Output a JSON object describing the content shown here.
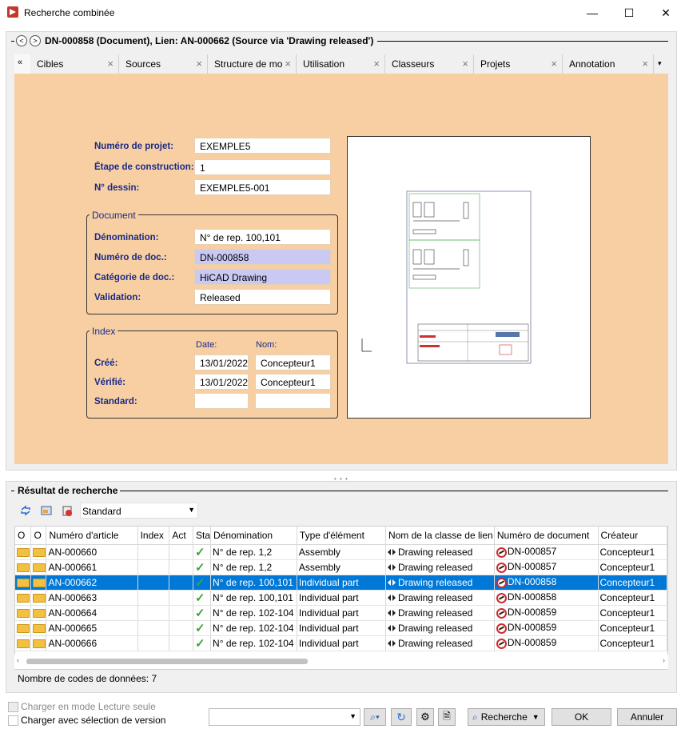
{
  "window": {
    "title": "Recherche combinée",
    "minimize": "—",
    "maximize": "☐",
    "close": "✕"
  },
  "header": {
    "prev": "<",
    "next": ">",
    "title": "DN-000858 (Document), Lien: AN-000662 (Source via 'Drawing released')"
  },
  "tabs": {
    "collapse": "«",
    "more": "▾",
    "items": [
      "Cibles",
      "Sources",
      "Structure de mo",
      "Utilisation",
      "Classeurs",
      "Projets",
      "Annotation"
    ]
  },
  "form": {
    "project_label": "Numéro de projet:",
    "project_value": "EXEMPLE5",
    "stage_label": "Étape de construction:",
    "stage_value": "1",
    "drawing_label": "N° dessin:",
    "drawing_value": "EXEMPLE5-001",
    "document_group": "Document",
    "name_label": "Dénomination:",
    "name_value": "N° de rep. 100,101",
    "docnum_label": "Numéro de doc.:",
    "docnum_value": "DN-000858",
    "category_label": "Catégorie de doc.:",
    "category_value": "HiCAD Drawing",
    "validation_label": "Validation:",
    "validation_value": "Released",
    "index_group": "Index",
    "date_col": "Date:",
    "name_col": "Nom:",
    "created_label": "Créé:",
    "created_date": "13/01/2022",
    "created_name": "Concepteur1",
    "checked_label": "Vérifié:",
    "checked_date": "13/01/2022",
    "checked_name": "Concepteur1",
    "standard_label": "Standard:",
    "standard_date": "",
    "standard_name": ""
  },
  "results": {
    "title": "Résultat de recherche",
    "view_combo": "Standard",
    "columns": [
      "O",
      "O",
      "Numéro d'article",
      "Index",
      "Act",
      "Sta",
      "Dénomination",
      "Type d'élément",
      "Nom de la classe de lien",
      "Numéro de document",
      "Créateur"
    ],
    "rows": [
      {
        "article": "AN-000660",
        "name": "N° de rep. 1,2",
        "type": "Assembly",
        "link": "Drawing released",
        "doc": "DN-000857",
        "creator": "Concepteur1",
        "selected": false
      },
      {
        "article": "AN-000661",
        "name": "N° de rep. 1,2",
        "type": "Assembly",
        "link": "Drawing released",
        "doc": "DN-000857",
        "creator": "Concepteur1",
        "selected": false
      },
      {
        "article": "AN-000662",
        "name": "N° de rep. 100,101",
        "type": "Individual part",
        "link": "Drawing released",
        "doc": "DN-000858",
        "creator": "Concepteur1",
        "selected": true
      },
      {
        "article": "AN-000663",
        "name": "N° de rep. 100,101",
        "type": "Individual part",
        "link": "Drawing released",
        "doc": "DN-000858",
        "creator": "Concepteur1",
        "selected": false
      },
      {
        "article": "AN-000664",
        "name": "N° de rep. 102-104",
        "type": "Individual part",
        "link": "Drawing released",
        "doc": "DN-000859",
        "creator": "Concepteur1",
        "selected": false
      },
      {
        "article": "AN-000665",
        "name": "N° de rep. 102-104",
        "type": "Individual part",
        "link": "Drawing released",
        "doc": "DN-000859",
        "creator": "Concepteur1",
        "selected": false
      },
      {
        "article": "AN-000666",
        "name": "N° de rep. 102-104",
        "type": "Individual part",
        "link": "Drawing released",
        "doc": "DN-000859",
        "creator": "Concepteur1",
        "selected": false
      }
    ],
    "count_text": "Nombre de codes de données: 7"
  },
  "bottom": {
    "readonly_label": "Charger en mode Lecture seule",
    "version_label": "Charger avec sélection de version",
    "search_button": "Recherche",
    "ok_button": "OK",
    "cancel_button": "Annuler"
  },
  "colors": {
    "form_bg": "#f7cfa3",
    "readonly_field": "#c9c9f3",
    "selection": "#0078d7",
    "label": "#1a2a8a"
  }
}
